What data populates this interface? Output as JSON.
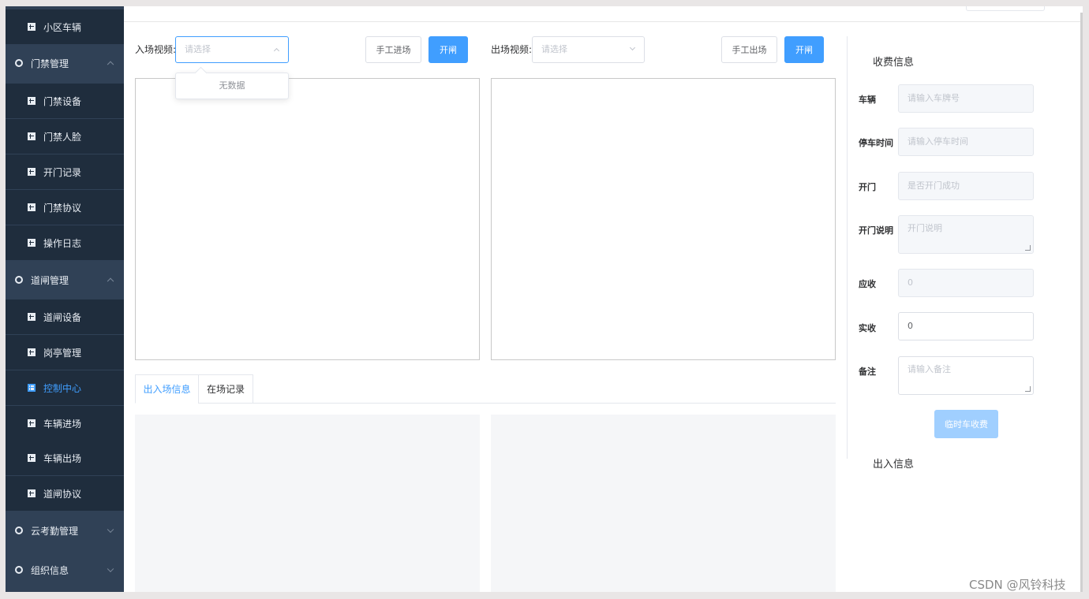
{
  "sidebar": {
    "items": [
      {
        "label": "小区车辆",
        "type": "sub",
        "icon": "grid-icon"
      },
      {
        "label": "门禁管理",
        "type": "group",
        "icon": "gear-icon",
        "expanded": true
      },
      {
        "label": "门禁设备",
        "type": "sub",
        "icon": "grid-icon"
      },
      {
        "label": "门禁人脸",
        "type": "sub",
        "icon": "grid-icon"
      },
      {
        "label": "开门记录",
        "type": "sub",
        "icon": "grid-icon"
      },
      {
        "label": "门禁协议",
        "type": "sub",
        "icon": "grid-icon"
      },
      {
        "label": "操作日志",
        "type": "sub",
        "icon": "grid-icon"
      },
      {
        "label": "道闸管理",
        "type": "group",
        "icon": "gear-icon",
        "expanded": true
      },
      {
        "label": "道闸设备",
        "type": "sub",
        "icon": "grid-icon"
      },
      {
        "label": "岗亭管理",
        "type": "sub",
        "icon": "grid-icon"
      },
      {
        "label": "控制中心",
        "type": "sub",
        "icon": "grid-icon",
        "active": true
      },
      {
        "label": "车辆进场",
        "type": "sub",
        "icon": "grid-icon"
      },
      {
        "label": "车辆出场",
        "type": "sub",
        "icon": "grid-icon"
      },
      {
        "label": "道闸协议",
        "type": "sub",
        "icon": "grid-icon"
      },
      {
        "label": "云考勤管理",
        "type": "group",
        "icon": "gear-icon",
        "expanded": false
      },
      {
        "label": "组织信息",
        "type": "group",
        "icon": "gear-icon",
        "expanded": false
      }
    ]
  },
  "controls": {
    "entry_label": "入场视频:",
    "entry_placeholder": "请选择",
    "manual_in": "手工进场",
    "open_gate_in": "开闸",
    "exit_label": "出场视频:",
    "exit_placeholder": "请选择",
    "manual_out": "手工出场",
    "open_gate_out": "开闸",
    "dropdown_empty": "无数据"
  },
  "tabs": [
    {
      "label": "出入场信息",
      "active": true
    },
    {
      "label": "在场记录",
      "active": false
    }
  ],
  "fee": {
    "title": "收费信息",
    "fields": [
      {
        "label": "车辆",
        "placeholder": "请输入车牌号",
        "value": ""
      },
      {
        "label": "停车时间",
        "placeholder": "请输入停车时间",
        "value": ""
      },
      {
        "label": "开门",
        "placeholder": "是否开门成功",
        "value": ""
      },
      {
        "label": "开门说明",
        "placeholder": "开门说明",
        "value": ""
      },
      {
        "label": "应收",
        "placeholder": "",
        "value": "0"
      },
      {
        "label": "实收",
        "placeholder": "",
        "value": "0"
      },
      {
        "label": "备注",
        "placeholder": "请输入备注",
        "value": ""
      }
    ],
    "charge_button": "临时车收费",
    "inout_title": "出入信息"
  },
  "watermark": "CSDN @风铃科技",
  "colors": {
    "sidebar_bg": "#304156",
    "submenu_bg": "#1f2d3d",
    "primary": "#409eff",
    "primary_disabled": "#a0cfff"
  }
}
